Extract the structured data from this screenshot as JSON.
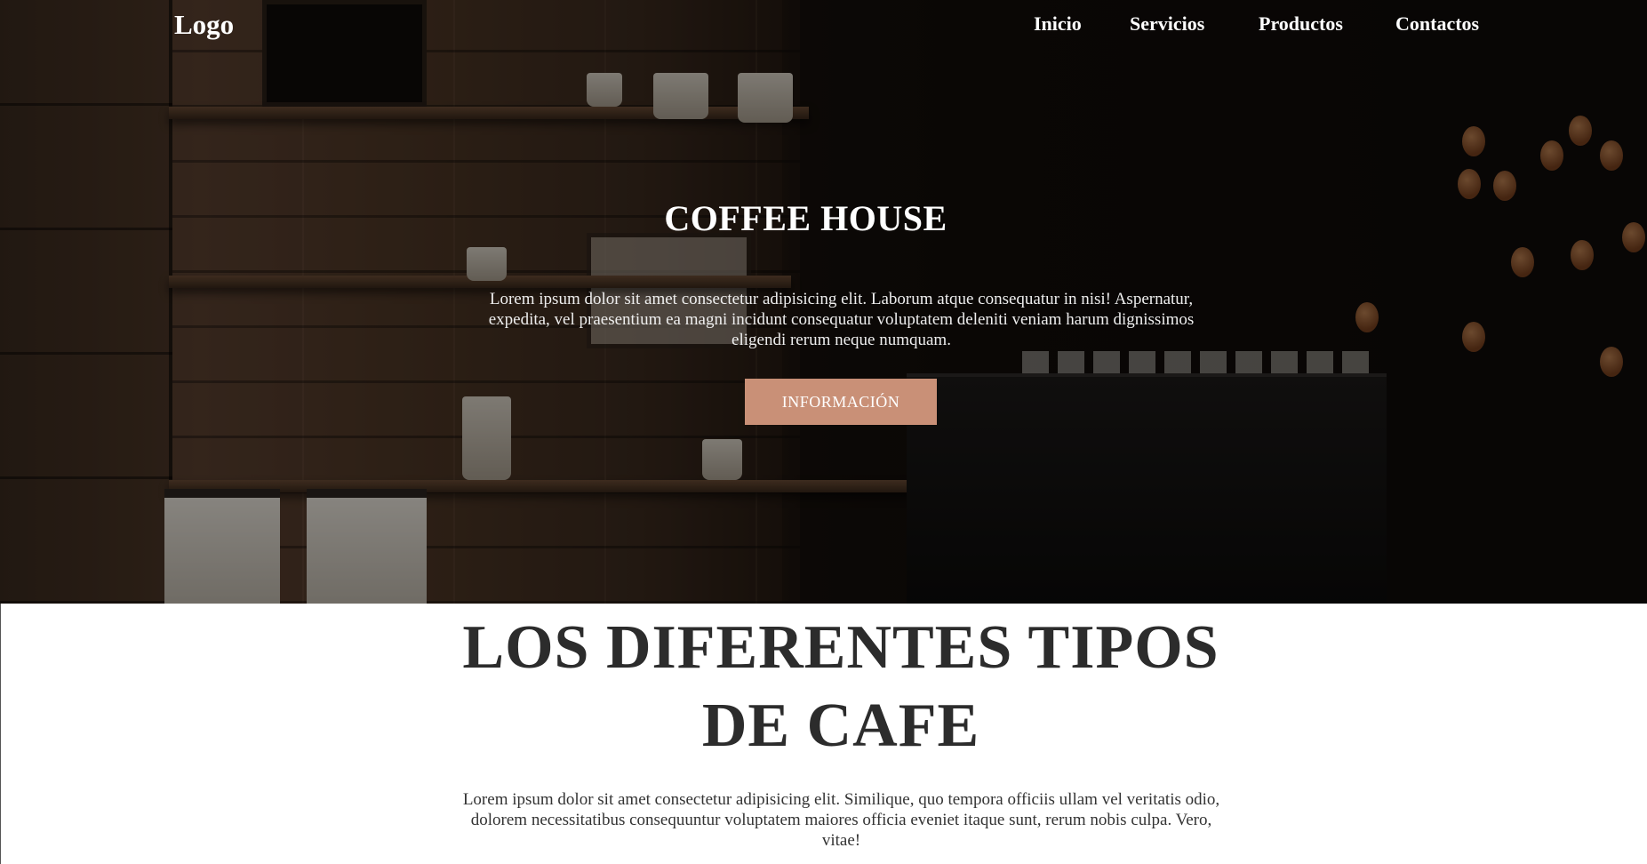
{
  "nav": {
    "logo": "Logo",
    "links": [
      "Inicio",
      "Servicios",
      "Productos",
      "Contactos"
    ]
  },
  "hero": {
    "title": "COFFEE HOUSE",
    "text": "Lorem ipsum dolor sit amet consectetur adipisicing elit. Laborum atque consequatur in nisi! Aspernatur, expedita, vel praesentium ea magni incidunt consequatur voluptatem deleniti veniam harum dignissimos eligendi rerum neque numquam.",
    "button_label": "INFORMACIÓN",
    "button_color": "#c99077"
  },
  "section": {
    "title": "LOS DIFERENTES TIPOS DE CAFE",
    "text": "Lorem ipsum dolor sit amet consectetur adipisicing elit. Similique, quo tempora officiis ullam vel veritatis odio, dolorem necessitatibus consequuntur voluptatem maiores officia eveniet itaque sunt, rerum nobis culpa. Vero, vitae!"
  }
}
